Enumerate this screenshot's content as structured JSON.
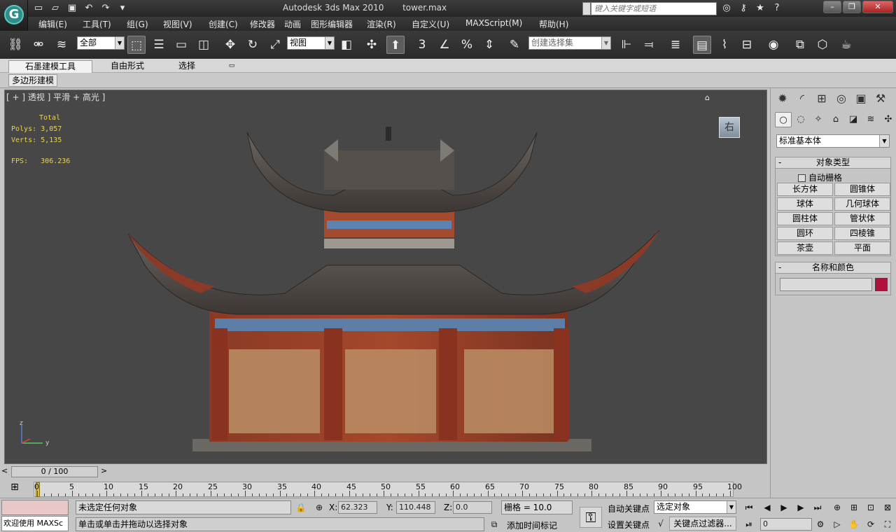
{
  "title": {
    "app": "Autodesk 3ds Max  2010",
    "file": "tower.max"
  },
  "search": {
    "placeholder": "键入关键字或短语"
  },
  "menu": [
    "编辑(E)",
    "工具(T)",
    "组(G)",
    "视图(V)",
    "创建(C)",
    "修改器",
    "动画",
    "图形编辑器",
    "渲染(R)",
    "自定义(U)",
    "MAXScript(M)",
    "帮助(H)"
  ],
  "toolbar": {
    "filter": "全部",
    "refcoord": "视图",
    "selset": "创建选择集",
    "snap_num": "3",
    "pct_snap": "%"
  },
  "ribbon": {
    "tabs": [
      "石墨建模工具",
      "自由形式",
      "选择"
    ],
    "panel": "多边形建模"
  },
  "viewport": {
    "label": "[ + ] 透视 ] 平滑 + 高光 ]",
    "stats": {
      "total": "Total",
      "polys_label": "Polys:",
      "polys": "3,057",
      "verts_label": "Verts:",
      "verts": "5,135",
      "fps_label": "FPS:",
      "fps": "306.236"
    },
    "viewcube": "右",
    "axis": {
      "z": "z",
      "y": "y"
    }
  },
  "timeline": {
    "slider": "0 / 100",
    "prev": "<",
    "next": ">",
    "ticks": [
      "0",
      "5",
      "10",
      "15",
      "20",
      "25",
      "30",
      "35",
      "40",
      "45",
      "50",
      "55",
      "60",
      "65",
      "70",
      "75",
      "80",
      "85",
      "90",
      "95",
      "100"
    ]
  },
  "command_panel": {
    "category": "标准基本体",
    "object_type": {
      "title": "对象类型",
      "autogrid": "自动栅格",
      "buttons": [
        "长方体",
        "圆锥体",
        "球体",
        "几何球体",
        "圆柱体",
        "管状体",
        "圆环",
        "四棱锥",
        "茶壶",
        "平面"
      ]
    },
    "name_color": {
      "title": "名称和颜色",
      "color": "#b0103a"
    }
  },
  "status": {
    "maxscript": "欢迎使用 MAXSc",
    "selection": "未选定任何对象",
    "prompt": "单击或单击并拖动以选择对象",
    "x_label": "X:",
    "x": "62.323",
    "y_label": "Y:",
    "y": "110.448",
    "z_label": "Z:",
    "z": "0.0",
    "grid": "栅格 = 10.0",
    "add_time_tag": "添加时间标记",
    "auto_key": "自动关键点",
    "set_key": "设置关键点",
    "key_mode": "选定对象",
    "key_filters": "关键点过滤器...",
    "frame": "0"
  }
}
